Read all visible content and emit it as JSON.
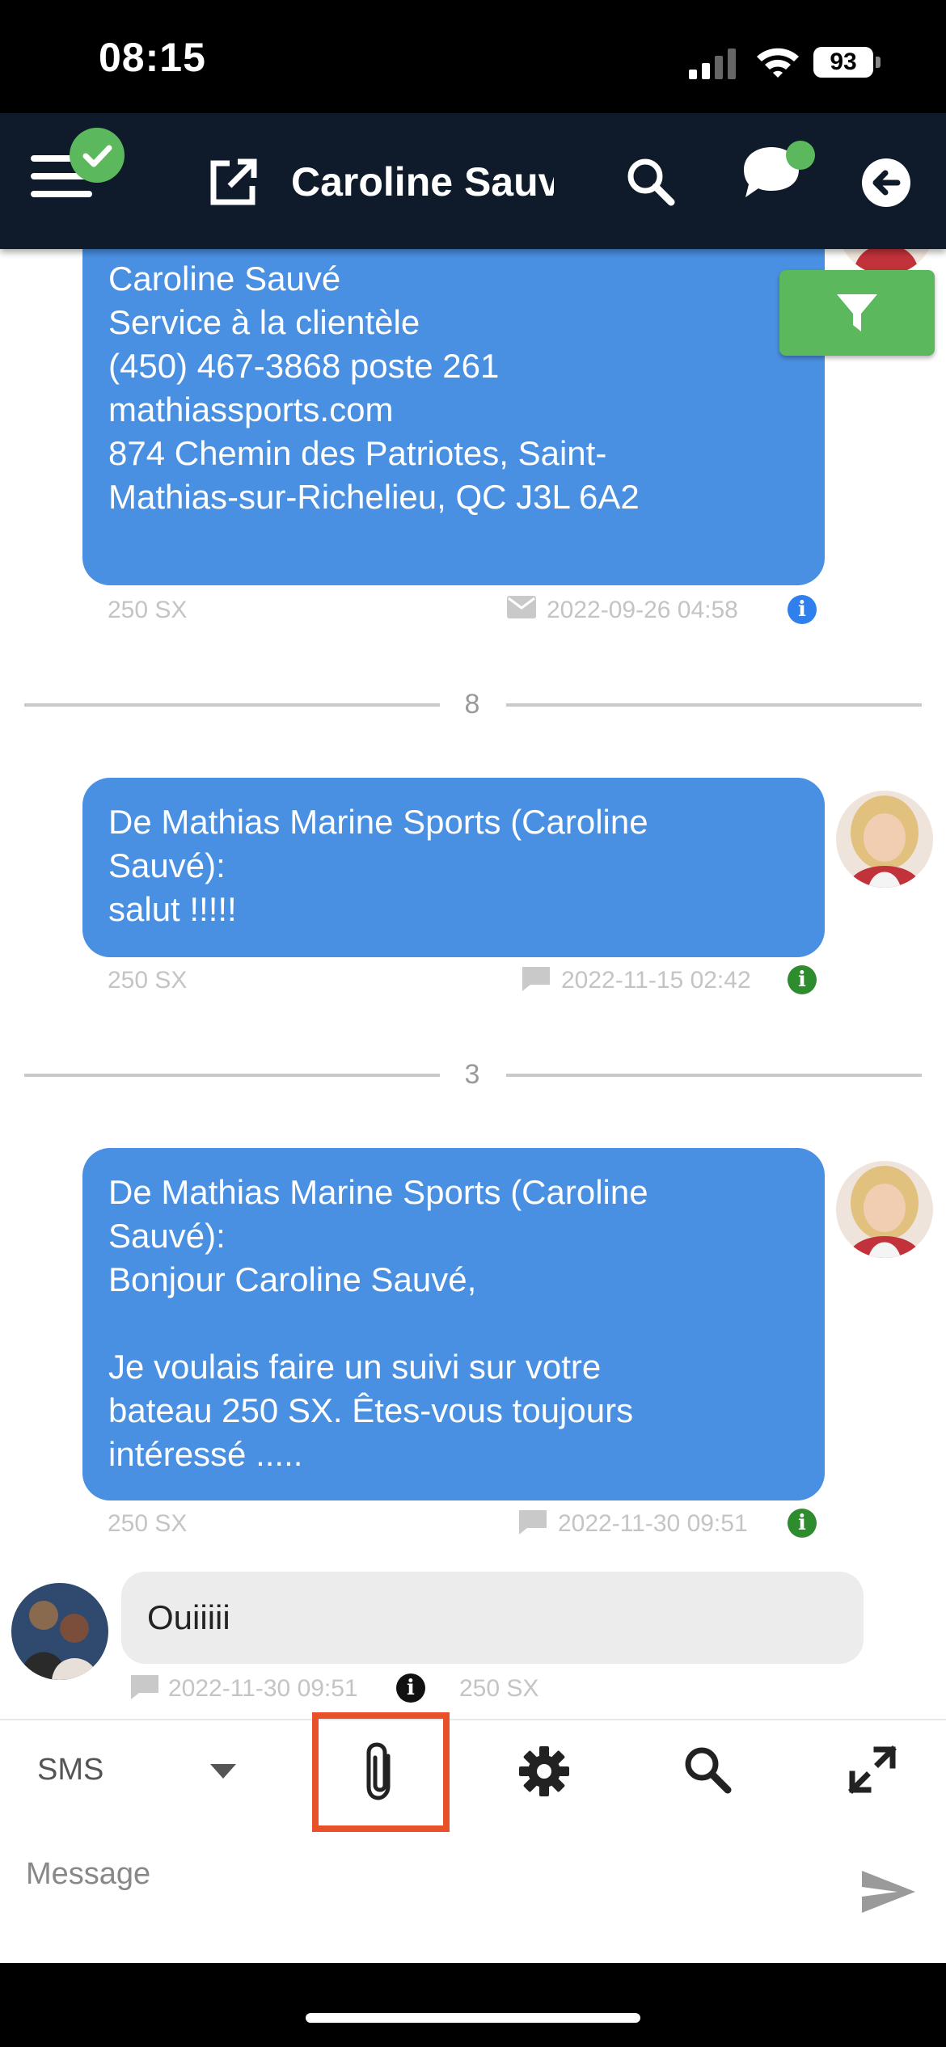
{
  "status_bar": {
    "time": "08:15",
    "battery": "93"
  },
  "header": {
    "title": "Caroline Sauv"
  },
  "messages": {
    "first": {
      "text": "Caroline Sauvé\nService à la clientèle\n(450) 467-3868 poste 261\nmathiassports.com\n874 Chemin des Patriotes, Saint-\nMathias-sur-Richelieu, QC J3L 6A2",
      "tag": "250 SX",
      "timestamp": "2022-09-26 04:58",
      "info_color": "#2f80ed"
    },
    "divider1": "8",
    "second": {
      "text": "De Mathias Marine Sports (Caroline\nSauvé):\nsalut !!!!!",
      "tag": "250 SX",
      "timestamp": "2022-11-15 02:42",
      "info_color": "#2e8b2e"
    },
    "divider2": "3",
    "third": {
      "text": "De Mathias Marine Sports (Caroline\nSauvé):\nBonjour Caroline Sauvé,\n\nJe voulais faire un suivi sur votre\nbateau 250 SX. Êtes-vous toujours\nintéressé .....",
      "tag": "250 SX",
      "timestamp": "2022-11-30 09:51",
      "info_color": "#2e8b2e"
    },
    "reply": {
      "text": "Ouiiiii",
      "timestamp": "2022-11-30 09:51",
      "tag": "250 SX"
    }
  },
  "composer": {
    "channel": "SMS",
    "placeholder": "Message"
  },
  "colors": {
    "header_bg": "#0f1b2a",
    "bubble_out": "#4a90e2",
    "filter": "#5cb85c",
    "highlight": "#e8502a"
  }
}
